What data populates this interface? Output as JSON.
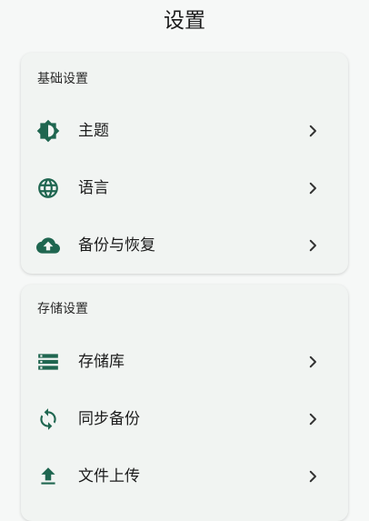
{
  "page": {
    "title": "设置"
  },
  "theme": {
    "accent": "#1f6650"
  },
  "sections": [
    {
      "title": "基础设置",
      "items": [
        {
          "label": "主题",
          "icon": "brightness-icon"
        },
        {
          "label": "语言",
          "icon": "globe-icon"
        },
        {
          "label": "备份与恢复",
          "icon": "cloud-upload-icon"
        }
      ]
    },
    {
      "title": "存储设置",
      "items": [
        {
          "label": "存储库",
          "icon": "storage-icon"
        },
        {
          "label": "同步备份",
          "icon": "sync-icon"
        },
        {
          "label": "文件上传",
          "icon": "upload-icon"
        }
      ]
    }
  ]
}
